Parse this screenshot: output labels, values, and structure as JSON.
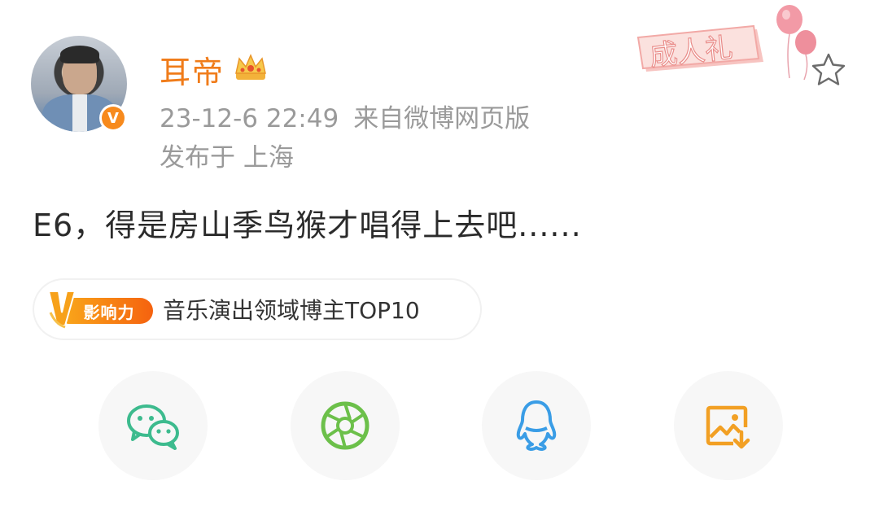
{
  "post": {
    "username": "耳帝",
    "time": "23-12-6 22:49",
    "source": "来自微博网页版",
    "location": "发布于 上海",
    "text": "E6，得是房山季鸟猴才唱得上去吧......"
  },
  "badge": {
    "verified_mark": "V",
    "decoration_text": "成人礼",
    "influence_label": "影响力",
    "influence_text": "音乐演出领域博主TOP10"
  },
  "share": [
    {
      "name": "wechat-icon",
      "color": "#3dbb8e"
    },
    {
      "name": "moments-icon",
      "color": "#6cc04a"
    },
    {
      "name": "qq-icon",
      "color": "#3a9de6"
    },
    {
      "name": "save-image-icon",
      "color": "#f2a024"
    }
  ],
  "colors": {
    "username": "#f07c1a",
    "meta": "#9a9a9a",
    "body_text": "#2b2b2b",
    "share_bg": "#f7f7f7"
  }
}
